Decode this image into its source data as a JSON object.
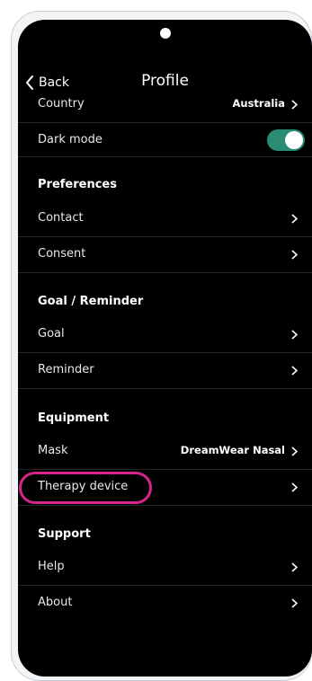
{
  "header": {
    "back_label": "Back",
    "title": "Profile"
  },
  "rows": {
    "country": {
      "label": "Country",
      "value": "Australia"
    },
    "dark_mode": {
      "label": "Dark mode",
      "enabled": true
    },
    "contact": {
      "label": "Contact"
    },
    "consent": {
      "label": "Consent"
    },
    "goal": {
      "label": "Goal"
    },
    "reminder": {
      "label": "Reminder"
    },
    "mask": {
      "label": "Mask",
      "value": "DreamWear Nasal"
    },
    "therapy_device": {
      "label": "Therapy device"
    },
    "help": {
      "label": "Help"
    },
    "about": {
      "label": "About"
    }
  },
  "sections": {
    "preferences": "Preferences",
    "goal_reminder": "Goal / Reminder",
    "equipment": "Equipment",
    "support": "Support"
  },
  "colors": {
    "toggle_on": "#2b8c73",
    "highlight": "#d6248a",
    "background": "#000000"
  },
  "icons": {
    "back": "chevron-left-icon",
    "row_arrow": "chevron-right-icon"
  }
}
